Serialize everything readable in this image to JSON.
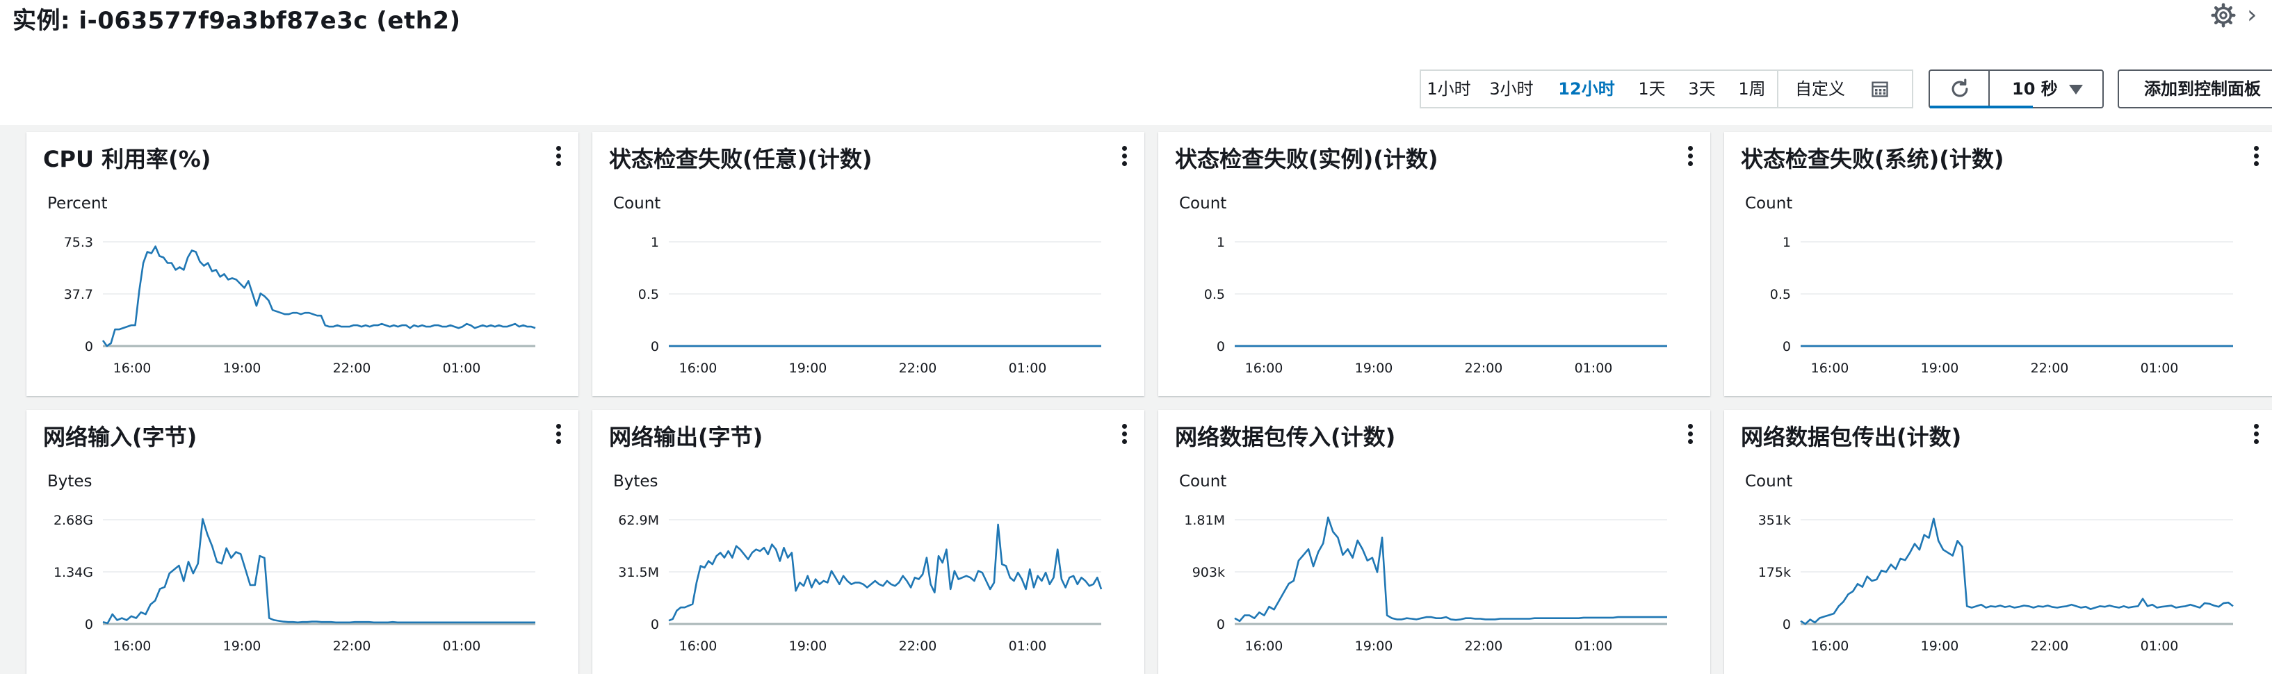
{
  "page": {
    "title": "实例: i-063577f9a3bf87e3c (eth2)",
    "settings_icon": "gear-icon",
    "collapse_icon": "chevron-right-icon"
  },
  "toolbar": {
    "time_ranges": [
      "1小时",
      "3小时",
      "12小时",
      "1天",
      "3天",
      "1周",
      "自定义"
    ],
    "active_range": "12小时",
    "calendar_icon": "calendar-icon",
    "refresh_icon": "refresh-icon",
    "refresh_interval": "10 秒",
    "add_to_dashboard": "添加到控制面板"
  },
  "colors": {
    "accent": "#0073bb",
    "series": "#1f77b4",
    "grid": "#e9ebed",
    "axis": "#aab7b8"
  },
  "x_tick_labels": [
    "16:00",
    "19:00",
    "22:00",
    "01:00"
  ],
  "widgets": [
    {
      "title": "CPU 利用率(%)",
      "unit": "Percent",
      "chart_data": {
        "type": "line",
        "x_ticks": [
          "16:00",
          "19:00",
          "22:00",
          "01:00"
        ],
        "y_ticks": [
          "75.3",
          "37.7",
          "0"
        ],
        "ylim": [
          0,
          75.3
        ],
        "series": [
          {
            "values": [
              4,
              0,
              2,
              12,
              12,
              13,
              14,
              15,
              15,
              40,
              60,
              68,
              67,
              72,
              65,
              64,
              60,
              60,
              55,
              57,
              55,
              64,
              69,
              68,
              61,
              58,
              60,
              54,
              55,
              50,
              52,
              48,
              49,
              48,
              45,
              42,
              47,
              38,
              29,
              38,
              36,
              33,
              26,
              25,
              24,
              23,
              23,
              24,
              24,
              23,
              24,
              24,
              23,
              22,
              22,
              15,
              14,
              14,
              15,
              14,
              14,
              14,
              15,
              15,
              14,
              15,
              14,
              15,
              15,
              16,
              15,
              14,
              15,
              14,
              15,
              15,
              13,
              15,
              14,
              15,
              14,
              14,
              15,
              15,
              14,
              14,
              15,
              14,
              13,
              14,
              16,
              15,
              13,
              14,
              15,
              14,
              15,
              14,
              15,
              14,
              14,
              15,
              16,
              14,
              15,
              14,
              14,
              13
            ]
          }
        ]
      }
    },
    {
      "title": "状态检查失败(任意)(计数)",
      "unit": "Count",
      "chart_data": {
        "type": "line",
        "x_ticks": [
          "16:00",
          "19:00",
          "22:00",
          "01:00"
        ],
        "y_ticks": [
          "1",
          "0.5",
          "0"
        ],
        "ylim": [
          0,
          1
        ],
        "series": [
          {
            "values": [
              0,
              0
            ]
          }
        ]
      }
    },
    {
      "title": "状态检查失败(实例)(计数)",
      "unit": "Count",
      "chart_data": {
        "type": "line",
        "x_ticks": [
          "16:00",
          "19:00",
          "22:00",
          "01:00"
        ],
        "y_ticks": [
          "1",
          "0.5",
          "0"
        ],
        "ylim": [
          0,
          1
        ],
        "series": [
          {
            "values": [
              0,
              0
            ]
          }
        ]
      }
    },
    {
      "title": "状态检查失败(系统)(计数)",
      "unit": "Count",
      "chart_data": {
        "type": "line",
        "x_ticks": [
          "16:00",
          "19:00",
          "22:00",
          "01:00"
        ],
        "y_ticks": [
          "1",
          "0.5",
          "0"
        ],
        "ylim": [
          0,
          1
        ],
        "series": [
          {
            "values": [
              0,
              0
            ]
          }
        ]
      }
    },
    {
      "title": "网络输入(字节)",
      "unit": "Bytes",
      "chart_data": {
        "type": "line",
        "x_ticks": [
          "16:00",
          "19:00",
          "22:00",
          "01:00"
        ],
        "y_ticks": [
          "2.68G",
          "1.34G",
          "0"
        ],
        "ylim": [
          0,
          2.68
        ],
        "series": [
          {
            "values": [
              0.05,
              0.02,
              0.25,
              0.1,
              0.15,
              0.1,
              0.2,
              0.15,
              0.3,
              0.25,
              0.5,
              0.6,
              0.9,
              0.95,
              1.3,
              1.4,
              1.5,
              1.1,
              1.6,
              1.3,
              1.55,
              2.7,
              2.3,
              2.0,
              1.6,
              1.55,
              1.95,
              1.7,
              1.85,
              1.8,
              1.4,
              1.0,
              1.0,
              1.75,
              1.7,
              0.15,
              0.1,
              0.08,
              0.06,
              0.05,
              0.05,
              0.04,
              0.05,
              0.05,
              0.06,
              0.06,
              0.05,
              0.05,
              0.05,
              0.04,
              0.04,
              0.04,
              0.04,
              0.05,
              0.05,
              0.05,
              0.05,
              0.04,
              0.04,
              0.04,
              0.04,
              0.05,
              0.04,
              0.04,
              0.04,
              0.04,
              0.04,
              0.04,
              0.04,
              0.04,
              0.04,
              0.04,
              0.04,
              0.04,
              0.04,
              0.04,
              0.04,
              0.04,
              0.04,
              0.04,
              0.04,
              0.04,
              0.04,
              0.04,
              0.04,
              0.04,
              0.04,
              0.04,
              0.04,
              0.04,
              0.04,
              0.04
            ]
          }
        ]
      }
    },
    {
      "title": "网络输出(字节)",
      "unit": "Bytes",
      "chart_data": {
        "type": "line",
        "x_ticks": [
          "16:00",
          "19:00",
          "22:00",
          "01:00"
        ],
        "y_ticks": [
          "62.9M",
          "31.5M",
          "0"
        ],
        "ylim": [
          0,
          62.9
        ],
        "series": [
          {
            "values": [
              2,
              3,
              8,
              10,
              10,
              11,
              12,
              25,
              35,
              34,
              38,
              36,
              41,
              43,
              40,
              44,
              40,
              47,
              45,
              42,
              39,
              43,
              45,
              44,
              46,
              42,
              48,
              45,
              38,
              46,
              40,
              43,
              20,
              25,
              23,
              29,
              22,
              27,
              24,
              26,
              25,
              32,
              28,
              24,
              29,
              26,
              24,
              25,
              25,
              24,
              22,
              24,
              26,
              24,
              23,
              26,
              24,
              23,
              25,
              29,
              26,
              22,
              28,
              27,
              30,
              40,
              24,
              19,
              41,
              37,
              45,
              21,
              32,
              27,
              28,
              29,
              28,
              26,
              32,
              31,
              26,
              21,
              25,
              60,
              36,
              35,
              28,
              26,
              31,
              27,
              21,
              33,
              22,
              29,
              26,
              31,
              24,
              28,
              45,
              27,
              22,
              28,
              29,
              24,
              28,
              26,
              23,
              24,
              28,
              21
            ]
          }
        ]
      }
    },
    {
      "title": "网络数据包传入(计数)",
      "unit": "Count",
      "chart_data": {
        "type": "line",
        "x_ticks": [
          "16:00",
          "19:00",
          "22:00",
          "01:00"
        ],
        "y_ticks": [
          "1.81M",
          "903k",
          "0"
        ],
        "ylim": [
          0,
          1.81
        ],
        "series": [
          {
            "values": [
              0.1,
              0.05,
              0.15,
              0.15,
              0.1,
              0.2,
              0.15,
              0.3,
              0.25,
              0.4,
              0.55,
              0.7,
              0.75,
              1.1,
              1.2,
              1.3,
              1.0,
              1.25,
              1.4,
              1.85,
              1.6,
              1.5,
              1.2,
              1.3,
              1.15,
              1.45,
              1.3,
              1.1,
              1.15,
              0.9,
              1.5,
              0.15,
              0.1,
              0.08,
              0.08,
              0.1,
              0.09,
              0.08,
              0.1,
              0.12,
              0.12,
              0.1,
              0.1,
              0.12,
              0.08,
              0.07,
              0.08,
              0.1,
              0.1,
              0.09,
              0.09,
              0.08,
              0.08,
              0.08,
              0.09,
              0.09,
              0.09,
              0.09,
              0.09,
              0.09,
              0.09,
              0.1,
              0.1,
              0.1,
              0.1,
              0.1,
              0.1,
              0.1,
              0.1,
              0.1,
              0.1,
              0.11,
              0.11,
              0.11,
              0.11,
              0.11,
              0.11,
              0.11,
              0.12,
              0.12,
              0.12,
              0.12,
              0.12,
              0.12,
              0.12,
              0.12,
              0.12,
              0.12,
              0.12
            ]
          }
        ]
      }
    },
    {
      "title": "网络数据包传出(计数)",
      "unit": "Count",
      "chart_data": {
        "type": "line",
        "x_ticks": [
          "16:00",
          "19:00",
          "22:00",
          "01:00"
        ],
        "y_ticks": [
          "351k",
          "175k",
          "0"
        ],
        "ylim": [
          0,
          351
        ],
        "series": [
          {
            "values": [
              10,
              0,
              15,
              5,
              20,
              25,
              30,
              35,
              60,
              75,
              100,
              110,
              135,
              125,
              160,
              145,
              150,
              180,
              175,
              200,
              185,
              220,
              215,
              240,
              270,
              250,
              300,
              290,
              355,
              280,
              250,
              240,
              230,
              280,
              260,
              60,
              55,
              60,
              65,
              55,
              60,
              58,
              62,
              57,
              60,
              55,
              58,
              62,
              60,
              55,
              60,
              58,
              62,
              57,
              55,
              58,
              60,
              65,
              60,
              55,
              58,
              50,
              55,
              60,
              58,
              62,
              58,
              55,
              60,
              55,
              58,
              60,
              85,
              60,
              65,
              55,
              58,
              60,
              62,
              55,
              58,
              60,
              65,
              60,
              55,
              70,
              68,
              62,
              58,
              70,
              72,
              60
            ]
          }
        ]
      }
    }
  ]
}
